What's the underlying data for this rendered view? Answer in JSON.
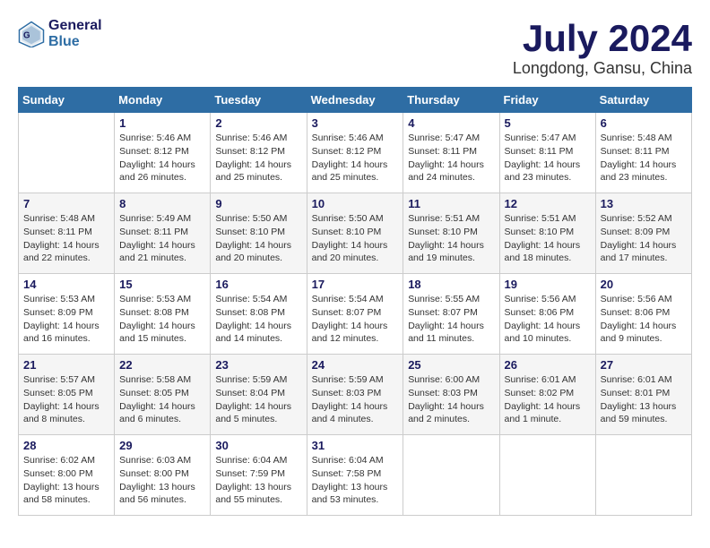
{
  "header": {
    "logo_general": "General",
    "logo_blue": "Blue",
    "month_year": "July 2024",
    "location": "Longdong, Gansu, China"
  },
  "columns": [
    "Sunday",
    "Monday",
    "Tuesday",
    "Wednesday",
    "Thursday",
    "Friday",
    "Saturday"
  ],
  "weeks": [
    {
      "days": [
        {
          "num": "",
          "info": ""
        },
        {
          "num": "1",
          "info": "Sunrise: 5:46 AM\nSunset: 8:12 PM\nDaylight: 14 hours\nand 26 minutes."
        },
        {
          "num": "2",
          "info": "Sunrise: 5:46 AM\nSunset: 8:12 PM\nDaylight: 14 hours\nand 25 minutes."
        },
        {
          "num": "3",
          "info": "Sunrise: 5:46 AM\nSunset: 8:12 PM\nDaylight: 14 hours\nand 25 minutes."
        },
        {
          "num": "4",
          "info": "Sunrise: 5:47 AM\nSunset: 8:11 PM\nDaylight: 14 hours\nand 24 minutes."
        },
        {
          "num": "5",
          "info": "Sunrise: 5:47 AM\nSunset: 8:11 PM\nDaylight: 14 hours\nand 23 minutes."
        },
        {
          "num": "6",
          "info": "Sunrise: 5:48 AM\nSunset: 8:11 PM\nDaylight: 14 hours\nand 23 minutes."
        }
      ]
    },
    {
      "days": [
        {
          "num": "7",
          "info": "Sunrise: 5:48 AM\nSunset: 8:11 PM\nDaylight: 14 hours\nand 22 minutes."
        },
        {
          "num": "8",
          "info": "Sunrise: 5:49 AM\nSunset: 8:11 PM\nDaylight: 14 hours\nand 21 minutes."
        },
        {
          "num": "9",
          "info": "Sunrise: 5:50 AM\nSunset: 8:10 PM\nDaylight: 14 hours\nand 20 minutes."
        },
        {
          "num": "10",
          "info": "Sunrise: 5:50 AM\nSunset: 8:10 PM\nDaylight: 14 hours\nand 20 minutes."
        },
        {
          "num": "11",
          "info": "Sunrise: 5:51 AM\nSunset: 8:10 PM\nDaylight: 14 hours\nand 19 minutes."
        },
        {
          "num": "12",
          "info": "Sunrise: 5:51 AM\nSunset: 8:10 PM\nDaylight: 14 hours\nand 18 minutes."
        },
        {
          "num": "13",
          "info": "Sunrise: 5:52 AM\nSunset: 8:09 PM\nDaylight: 14 hours\nand 17 minutes."
        }
      ]
    },
    {
      "days": [
        {
          "num": "14",
          "info": "Sunrise: 5:53 AM\nSunset: 8:09 PM\nDaylight: 14 hours\nand 16 minutes."
        },
        {
          "num": "15",
          "info": "Sunrise: 5:53 AM\nSunset: 8:08 PM\nDaylight: 14 hours\nand 15 minutes."
        },
        {
          "num": "16",
          "info": "Sunrise: 5:54 AM\nSunset: 8:08 PM\nDaylight: 14 hours\nand 14 minutes."
        },
        {
          "num": "17",
          "info": "Sunrise: 5:54 AM\nSunset: 8:07 PM\nDaylight: 14 hours\nand 12 minutes."
        },
        {
          "num": "18",
          "info": "Sunrise: 5:55 AM\nSunset: 8:07 PM\nDaylight: 14 hours\nand 11 minutes."
        },
        {
          "num": "19",
          "info": "Sunrise: 5:56 AM\nSunset: 8:06 PM\nDaylight: 14 hours\nand 10 minutes."
        },
        {
          "num": "20",
          "info": "Sunrise: 5:56 AM\nSunset: 8:06 PM\nDaylight: 14 hours\nand 9 minutes."
        }
      ]
    },
    {
      "days": [
        {
          "num": "21",
          "info": "Sunrise: 5:57 AM\nSunset: 8:05 PM\nDaylight: 14 hours\nand 8 minutes."
        },
        {
          "num": "22",
          "info": "Sunrise: 5:58 AM\nSunset: 8:05 PM\nDaylight: 14 hours\nand 6 minutes."
        },
        {
          "num": "23",
          "info": "Sunrise: 5:59 AM\nSunset: 8:04 PM\nDaylight: 14 hours\nand 5 minutes."
        },
        {
          "num": "24",
          "info": "Sunrise: 5:59 AM\nSunset: 8:03 PM\nDaylight: 14 hours\nand 4 minutes."
        },
        {
          "num": "25",
          "info": "Sunrise: 6:00 AM\nSunset: 8:03 PM\nDaylight: 14 hours\nand 2 minutes."
        },
        {
          "num": "26",
          "info": "Sunrise: 6:01 AM\nSunset: 8:02 PM\nDaylight: 14 hours\nand 1 minute."
        },
        {
          "num": "27",
          "info": "Sunrise: 6:01 AM\nSunset: 8:01 PM\nDaylight: 13 hours\nand 59 minutes."
        }
      ]
    },
    {
      "days": [
        {
          "num": "28",
          "info": "Sunrise: 6:02 AM\nSunset: 8:00 PM\nDaylight: 13 hours\nand 58 minutes."
        },
        {
          "num": "29",
          "info": "Sunrise: 6:03 AM\nSunset: 8:00 PM\nDaylight: 13 hours\nand 56 minutes."
        },
        {
          "num": "30",
          "info": "Sunrise: 6:04 AM\nSunset: 7:59 PM\nDaylight: 13 hours\nand 55 minutes."
        },
        {
          "num": "31",
          "info": "Sunrise: 6:04 AM\nSunset: 7:58 PM\nDaylight: 13 hours\nand 53 minutes."
        },
        {
          "num": "",
          "info": ""
        },
        {
          "num": "",
          "info": ""
        },
        {
          "num": "",
          "info": ""
        }
      ]
    }
  ]
}
